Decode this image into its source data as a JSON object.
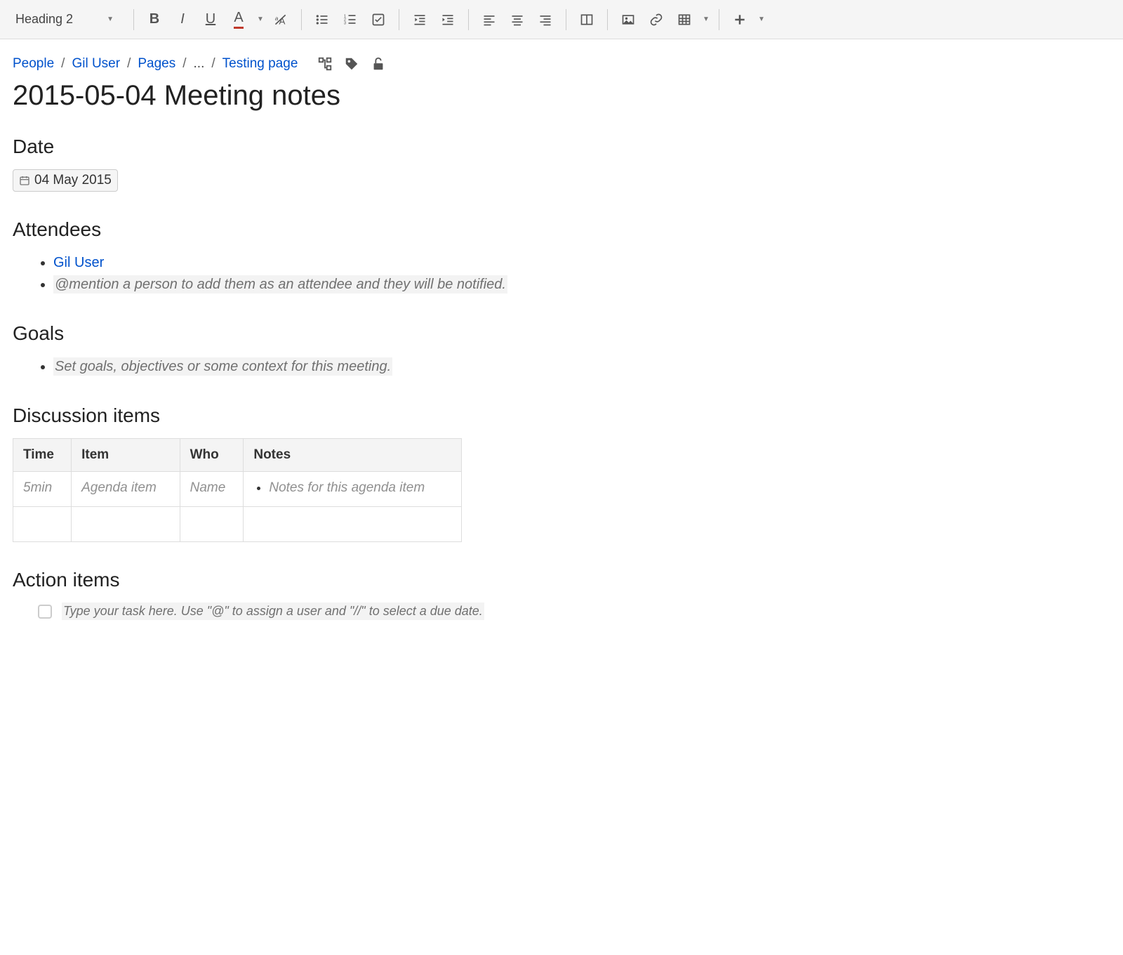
{
  "toolbar": {
    "style_selector": "Heading 2",
    "bold": "B",
    "italic": "I",
    "underline": "U",
    "color": "A"
  },
  "breadcrumb": {
    "items": [
      "People",
      "Gil User",
      "Pages",
      "...",
      "Testing page"
    ]
  },
  "page": {
    "title": "2015-05-04 Meeting notes"
  },
  "sections": {
    "date": {
      "heading": "Date",
      "value": "04 May 2015"
    },
    "attendees": {
      "heading": "Attendees",
      "items": [
        {
          "text": "Gil User",
          "type": "link"
        },
        {
          "text": "@mention a person to add them as an attendee and they will be notified.",
          "type": "placeholder"
        }
      ]
    },
    "goals": {
      "heading": "Goals",
      "items": [
        {
          "text": "Set goals, objectives or some context for this meeting.",
          "type": "placeholder"
        }
      ]
    },
    "discussion": {
      "heading": "Discussion items",
      "columns": [
        "Time",
        "Item",
        "Who",
        "Notes"
      ],
      "rows": [
        {
          "time": "5min",
          "item": "Agenda item",
          "who": "Name",
          "notes": "Notes for this agenda item"
        },
        {
          "time": "",
          "item": "",
          "who": "",
          "notes": ""
        }
      ]
    },
    "action": {
      "heading": "Action items",
      "task_placeholder": "Type your task here. Use \"@\" to assign a user and \"//\" to select a due date."
    }
  }
}
